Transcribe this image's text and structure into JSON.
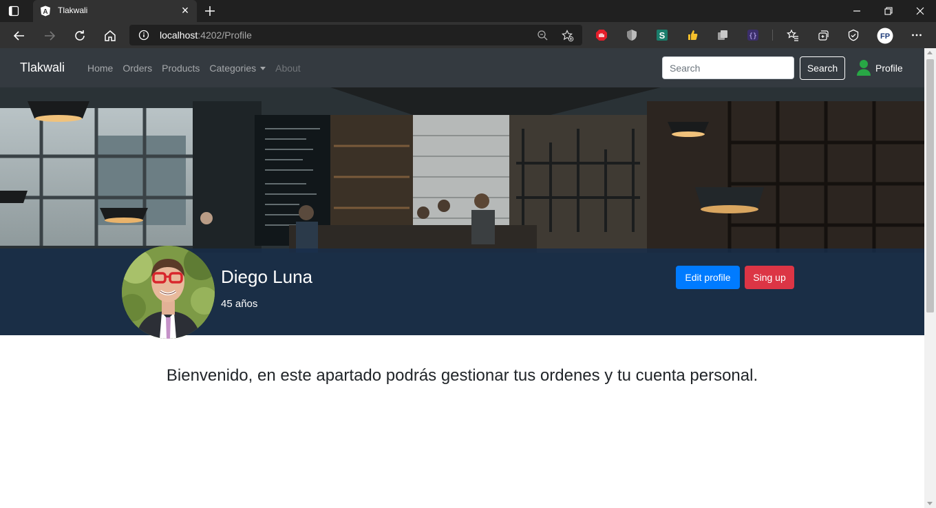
{
  "browser": {
    "tab_title": "Tlakwali",
    "url_host": "localhost",
    "url_path": ":4202/Profile"
  },
  "navbar": {
    "brand": "Tlakwali",
    "links": [
      "Home",
      "Orders",
      "Products",
      "Categories",
      "About"
    ],
    "search_placeholder": "Search",
    "search_button": "Search",
    "profile_label": "Profile"
  },
  "profile": {
    "name": "Diego Luna",
    "age": "45 años",
    "edit_button": "Edit profile",
    "signup_button": "Sing up"
  },
  "main": {
    "welcome": "Bienvenido, en este apartado podrás gestionar tus ordenes y tu cuenta personal."
  },
  "colors": {
    "navbar_bg": "#343a40",
    "primary": "#007bff",
    "danger": "#dc3545",
    "profile_icon": "#28a745"
  }
}
